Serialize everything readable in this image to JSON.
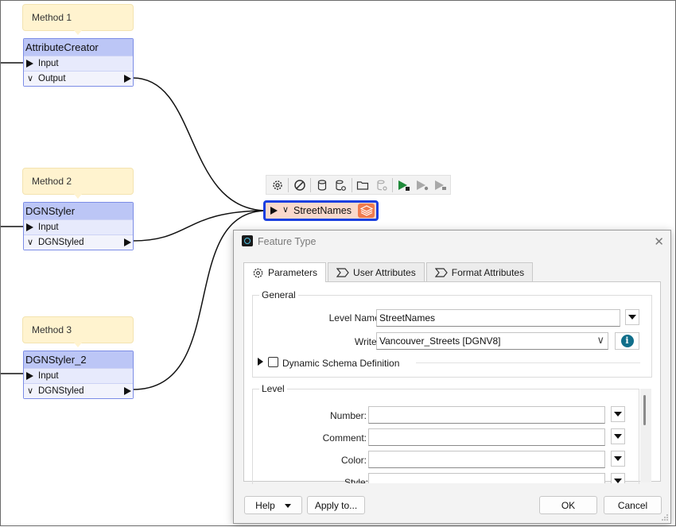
{
  "workspace": {
    "annotations": [
      "Method 1",
      "Method 2",
      "Method 3"
    ],
    "transformers": [
      {
        "name": "AttributeCreator",
        "input": "Input",
        "output": "Output"
      },
      {
        "name": "DGNStyler",
        "input": "Input",
        "output": "DGNStyled"
      },
      {
        "name": "DGNStyler_2",
        "input": "Input",
        "output": "DGNStyled"
      }
    ],
    "toolbar_icons": [
      "gear-icon",
      "disable-icon",
      "cache-icon",
      "cache-settings-icon",
      "open-folder-icon",
      "inspect-cache-icon",
      "run-to-this-icon",
      "run-from-this-icon",
      "run-just-this-icon"
    ],
    "feature_type": {
      "name": "StreetNames",
      "accent": "#1a3fe0",
      "fill": "#f9d9cc",
      "icon_color": "#f07b4e"
    }
  },
  "dialog": {
    "title": "Feature Type",
    "tabs": [
      "Parameters",
      "User Attributes",
      "Format Attributes"
    ],
    "general": {
      "label": "General",
      "level_name_label": "Level Name:",
      "level_name_value": "StreetNames",
      "writer_label": "Writer:",
      "writer_value": "Vancouver_Streets [DGNV8]",
      "dynamic_schema_label": "Dynamic Schema Definition"
    },
    "level": {
      "label": "Level",
      "fields": [
        {
          "label": "Number:",
          "value": ""
        },
        {
          "label": "Comment:",
          "value": ""
        },
        {
          "label": "Color:",
          "value": ""
        },
        {
          "label": "Style:",
          "value": ""
        }
      ]
    },
    "buttons": {
      "help": "Help",
      "apply": "Apply to...",
      "ok": "OK",
      "cancel": "Cancel"
    }
  }
}
